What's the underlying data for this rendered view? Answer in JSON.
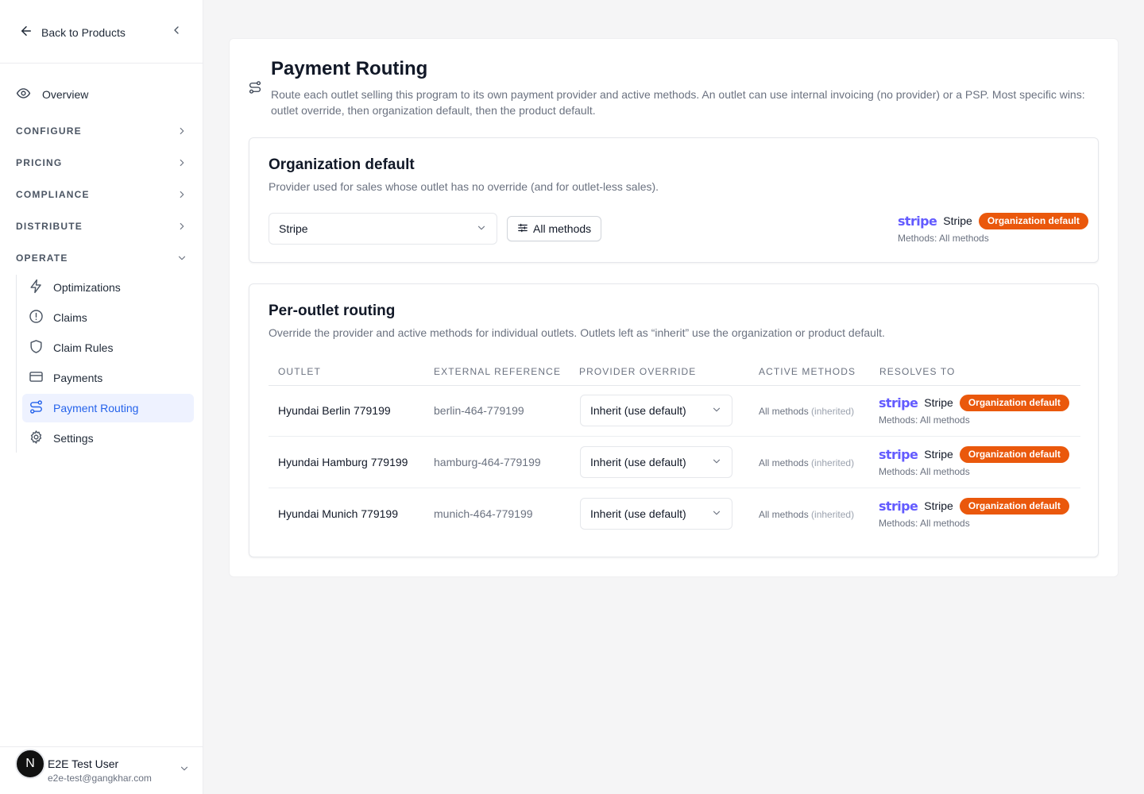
{
  "sidebar": {
    "back_label": "Back to Products",
    "overview_label": "Overview",
    "sections": [
      {
        "label": "CONFIGURE"
      },
      {
        "label": "PRICING"
      },
      {
        "label": "COMPLIANCE"
      },
      {
        "label": "DISTRIBUTE"
      },
      {
        "label": "OPERATE"
      }
    ],
    "operate_items": [
      {
        "label": "Optimizations",
        "icon": "lightning-icon"
      },
      {
        "label": "Claims",
        "icon": "alert-circle-icon"
      },
      {
        "label": "Claim Rules",
        "icon": "shield-icon"
      },
      {
        "label": "Payments",
        "icon": "credit-card-icon"
      },
      {
        "label": "Payment Routing",
        "icon": "route-icon",
        "active": true
      },
      {
        "label": "Settings",
        "icon": "gear-icon"
      }
    ],
    "user": {
      "avatar_initial": "N",
      "name": "E2E Test User",
      "email": "e2e-test@gangkhar.com"
    }
  },
  "page": {
    "title": "Payment Routing",
    "description": "Route each outlet selling this program to its own payment provider and active methods. An outlet can use internal invoicing (no provider) or a PSP. Most specific wins: outlet override, then organization default, then the product default."
  },
  "org_default": {
    "title": "Organization default",
    "description": "Provider used for sales whose outlet has no override (and for outlet-less sales).",
    "provider_select_value": "Stripe",
    "methods_button_label": "All methods",
    "resolves": {
      "logo_text": "stripe",
      "provider": "Stripe",
      "badge": "Organization default",
      "methods": "Methods: All methods"
    }
  },
  "per_outlet": {
    "title": "Per-outlet routing",
    "description": "Override the provider and active methods for individual outlets. Outlets left as “inherit” use the organization or product default.",
    "columns": [
      "OUTLET",
      "EXTERNAL REFERENCE",
      "PROVIDER OVERRIDE",
      "ACTIVE METHODS",
      "RESOLVES TO"
    ],
    "rows": [
      {
        "outlet": "Hyundai Berlin 779199",
        "external_ref": "berlin-464-779199",
        "provider_override": "Inherit (use default)",
        "active_methods": "All methods",
        "inherited_tag": "(inherited)",
        "resolves_logo": "stripe",
        "resolves_provider": "Stripe",
        "resolves_badge": "Organization default",
        "resolves_methods": "Methods: All methods"
      },
      {
        "outlet": "Hyundai Hamburg 779199",
        "external_ref": "hamburg-464-779199",
        "provider_override": "Inherit (use default)",
        "active_methods": "All methods",
        "inherited_tag": "(inherited)",
        "resolves_logo": "stripe",
        "resolves_provider": "Stripe",
        "resolves_badge": "Organization default",
        "resolves_methods": "Methods: All methods"
      },
      {
        "outlet": "Hyundai Munich 779199",
        "external_ref": "munich-464-779199",
        "provider_override": "Inherit (use default)",
        "active_methods": "All methods",
        "inherited_tag": "(inherited)",
        "resolves_logo": "stripe",
        "resolves_provider": "Stripe",
        "resolves_badge": "Organization default",
        "resolves_methods": "Methods: All methods"
      }
    ]
  },
  "colors": {
    "accent": "#2563eb",
    "badge": "#ea580c",
    "stripe": "#635bff"
  }
}
